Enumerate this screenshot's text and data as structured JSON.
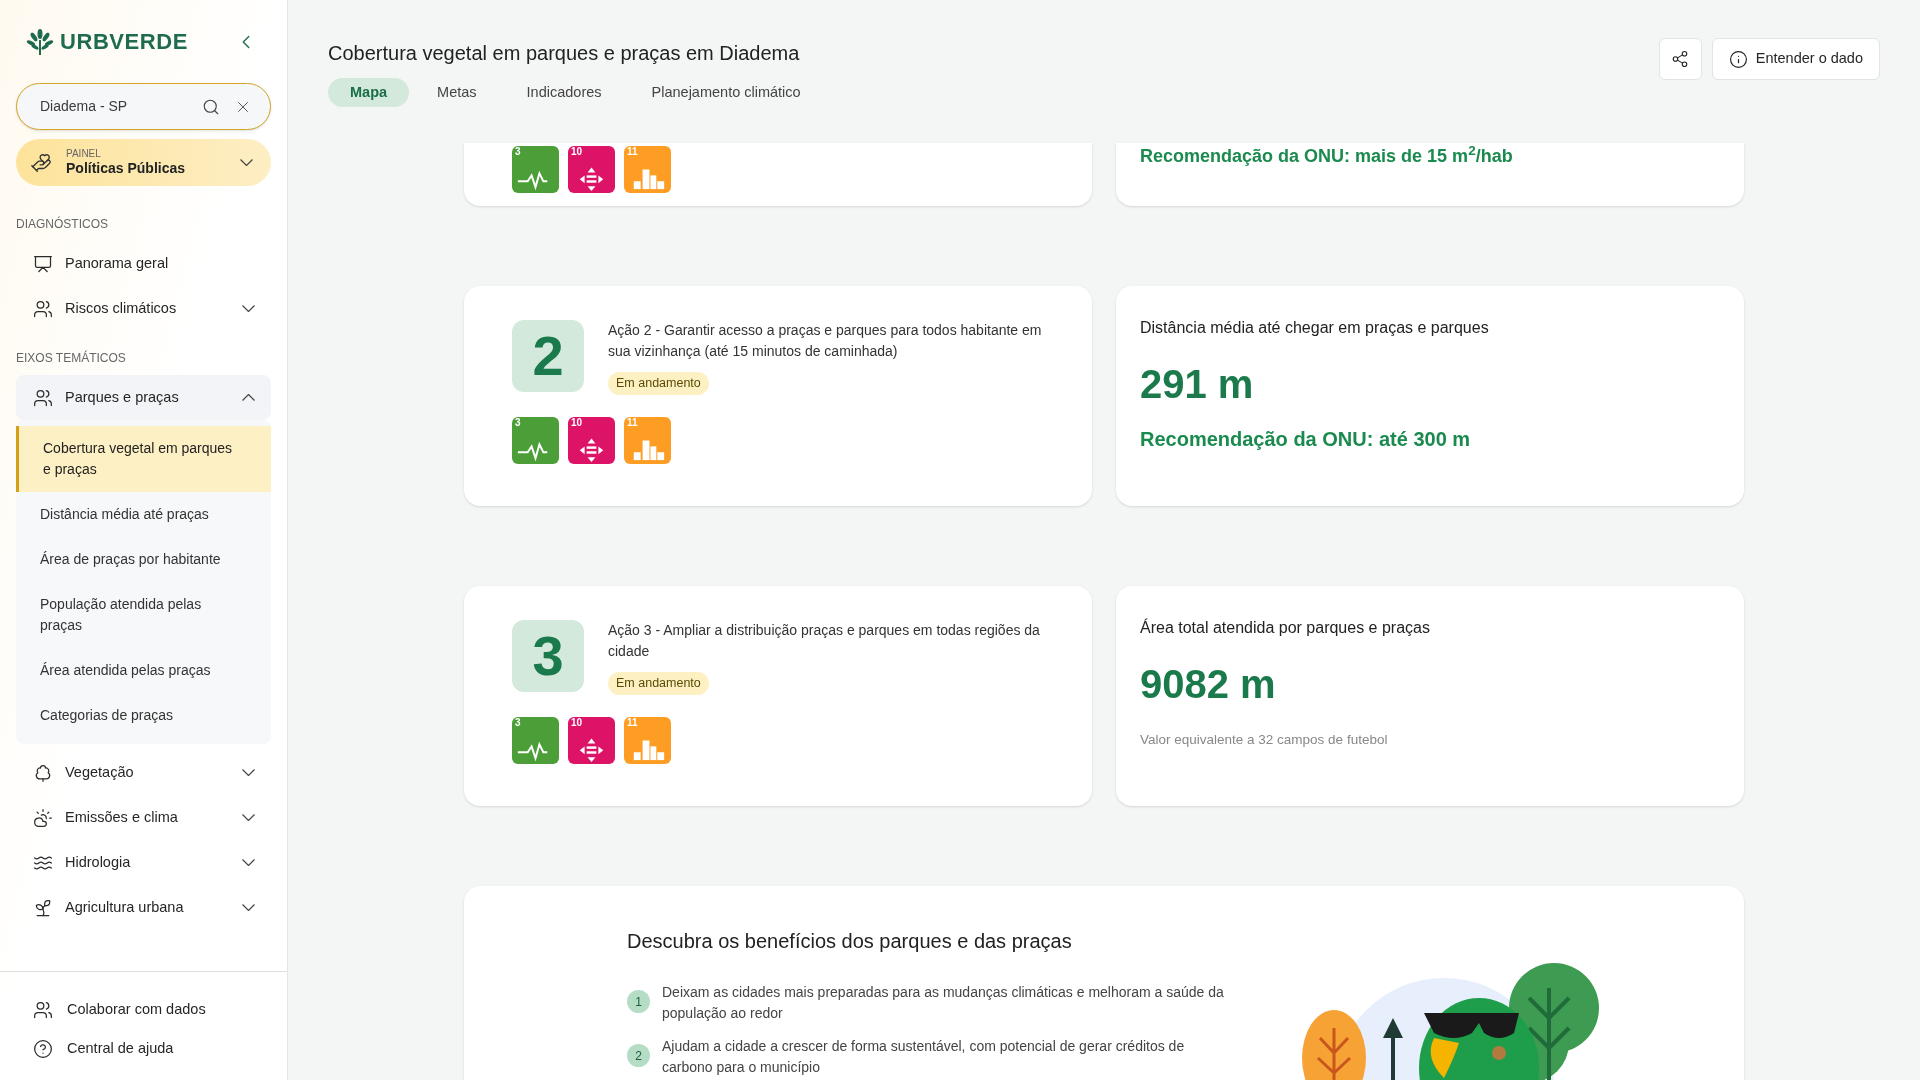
{
  "brand": {
    "name": "URBVERDE"
  },
  "search": {
    "value": "Diadema - SP"
  },
  "panel": {
    "caption": "PAINEL",
    "title": "Políticas Públicas"
  },
  "sidebar": {
    "sections": [
      {
        "title": "DIAGNÓSTICOS",
        "items": [
          {
            "label": "Panorama geral",
            "kind": "presentation",
            "expandable": false,
            "expanded": false
          },
          {
            "label": "Riscos climáticos",
            "kind": "people-land",
            "expandable": true,
            "expanded": false
          }
        ]
      },
      {
        "title": "EIXOS TEMÁTICOS",
        "items": [
          {
            "label": "Parques e praças",
            "kind": "people-land",
            "expandable": true,
            "expanded": true,
            "children": [
              {
                "label": "Cobertura vegetal em parques e praças",
                "selected": true
              },
              {
                "label": "Distância média até praças",
                "selected": false
              },
              {
                "label": "Área de praças por habitante",
                "selected": false
              },
              {
                "label": "População atendida pelas praças",
                "selected": false
              },
              {
                "label": "Área atendida pelas praças",
                "selected": false
              },
              {
                "label": "Categorias de praças",
                "selected": false
              }
            ]
          },
          {
            "label": "Vegetação",
            "kind": "tree",
            "expandable": true,
            "expanded": false
          },
          {
            "label": "Emissões e clima",
            "kind": "cloud-sun",
            "expandable": true,
            "expanded": false
          },
          {
            "label": "Hidrologia",
            "kind": "waves",
            "expandable": true,
            "expanded": false
          },
          {
            "label": "Agricultura urbana",
            "kind": "sprout",
            "expandable": true,
            "expanded": false
          }
        ]
      }
    ],
    "footer": [
      {
        "label": "Colaborar com dados",
        "kind": "users"
      },
      {
        "label": "Central de ajuda",
        "kind": "help"
      }
    ]
  },
  "header": {
    "title": "Cobertura vegetal em parques e praças em Diadema",
    "tabs": [
      {
        "label": "Mapa",
        "selected": true
      },
      {
        "label": "Metas",
        "selected": false
      },
      {
        "label": "Indicadores",
        "selected": false
      },
      {
        "label": "Planejamento climático",
        "selected": false
      }
    ],
    "actions": [
      {
        "kind": "share"
      },
      {
        "kind": "info",
        "label": "Entender o dado"
      }
    ]
  },
  "cut_off_row": {
    "sdgs": [
      {
        "number": "3",
        "kind": "health",
        "color": "#4c9f38"
      },
      {
        "number": "10",
        "kind": "inequality",
        "color": "#dd1367"
      },
      {
        "number": "11",
        "kind": "cities",
        "color": "#fd9d24"
      }
    ],
    "recommendation": "Recomendação da ONU: mais de 15 m$^{2}$/hab"
  },
  "goals": [
    {
      "number": "2",
      "text": "Ação 2 - Garantir acesso a praças e parques para todos habitante em sua vizinhança (até 15 minutos de caminhada)",
      "status": "Em andamento",
      "sdgs": [
        {
          "number": "3",
          "kind": "health",
          "color": "#4c9f38"
        },
        {
          "number": "10",
          "kind": "inequality",
          "color": "#dd1367"
        },
        {
          "number": "11",
          "kind": "cities",
          "color": "#fd9d24"
        }
      ],
      "indicator": {
        "title": "Distância média até chegar em praças e parques",
        "value": "291 m",
        "note": "Recomendação da ONU: até 300 m",
        "kind": "recommendation"
      }
    },
    {
      "number": "3",
      "text": "Ação 3 - Ampliar a distribuição praças e parques em todas regiões da cidade",
      "status": "Em andamento",
      "sdgs": [
        {
          "number": "3",
          "kind": "health",
          "color": "#4c9f38"
        },
        {
          "number": "10",
          "kind": "inequality",
          "color": "#dd1367"
        },
        {
          "number": "11",
          "kind": "cities",
          "color": "#fd9d24"
        }
      ],
      "indicator": {
        "title": "Área total atendida por parques e praças",
        "value": "9082 m",
        "note": "Valor equivalente a 32 campos de futebol",
        "kind": "comparison"
      }
    }
  ],
  "benefits": {
    "title": "Descubra os benefícios dos parques e das praças",
    "items": [
      {
        "number": "1",
        "text": "Deixam as cidades mais preparadas para as mudanças climáticas e melhoram a saúde da população ao redor"
      },
      {
        "number": "2",
        "text": "Ajudam a cidade a crescer de forma sustentável, com potencial de gerar créditos de carbono para o município"
      }
    ]
  }
}
